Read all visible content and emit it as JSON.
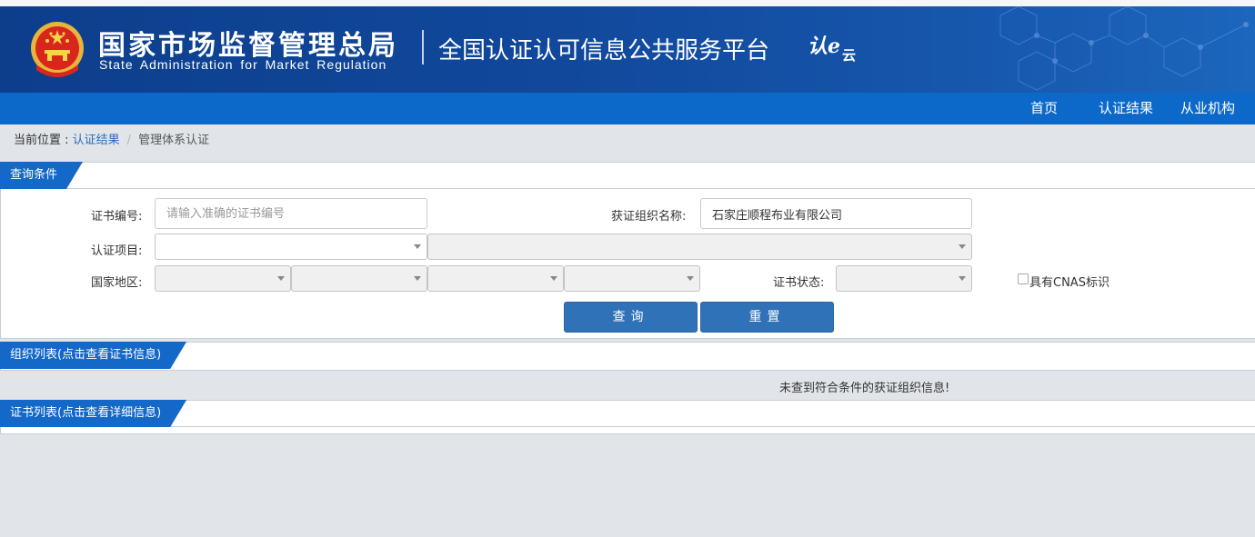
{
  "header": {
    "cn_title": "国家市场监督管理总局",
    "en_title": "State Administration  for  Market Regulation",
    "platform_title": "全国认证认可信息公共服务平台",
    "renyun_logo_text": "认e云"
  },
  "nav": {
    "items": [
      {
        "label": "首页"
      },
      {
        "label": "认证结果"
      },
      {
        "label": "从业机构"
      }
    ]
  },
  "breadcrumb": {
    "prefix": "当前位置 : ",
    "link": "认证结果",
    "separator": "/",
    "current": "管理体系认证"
  },
  "query_panel": {
    "title": "查询条件",
    "cert_no_label": "证书编号:",
    "cert_no_placeholder": "请输入准确的证书编号",
    "cert_no_value": "",
    "org_name_label": "获证组织名称:",
    "org_name_value": "石家庄顺程布业有限公司",
    "project_label": "认证项目:",
    "region_label": "国家地区:",
    "status_label": "证书状态:",
    "cnas_label": "具有CNAS标识",
    "search_button": "查询",
    "reset_button": "重置"
  },
  "org_panel": {
    "title": "组织列表(点击查看证书信息)",
    "empty_message": "未查到符合条件的获证组织信息!"
  },
  "cert_panel": {
    "title": "证书列表(点击查看详细信息)"
  },
  "colors": {
    "header_bg": "#11489c",
    "nav_bg": "#0c69c9",
    "tab_bg": "#1368c8",
    "button_bg": "#2f72b8",
    "page_bg": "#e1e5ea"
  }
}
